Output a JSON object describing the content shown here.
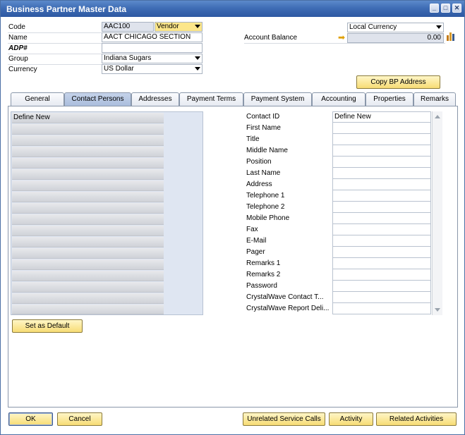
{
  "window": {
    "title": "Business Partner Master Data"
  },
  "header": {
    "code_label": "Code",
    "code_value": "AAC100",
    "type_value": "Vendor",
    "name_label": "Name",
    "name_value": "AACT CHICAGO SECTION",
    "adp_label": "ADP#",
    "adp_value": "",
    "group_label": "Group",
    "group_value": "Indiana Sugars",
    "currency_label": "Currency",
    "currency_value": "US Dollar",
    "currency_mode_value": "Local Currency",
    "account_balance_label": "Account Balance",
    "account_balance_value": "0.00",
    "copy_bp_address_label": "Copy BP Address"
  },
  "tabs": [
    {
      "label": "General"
    },
    {
      "label": "Contact Persons"
    },
    {
      "label": "Addresses"
    },
    {
      "label": "Payment Terms"
    },
    {
      "label": "Payment System"
    },
    {
      "label": "Accounting"
    },
    {
      "label": "Properties"
    },
    {
      "label": "Remarks"
    }
  ],
  "contacts_list": {
    "items": [
      "Define New"
    ],
    "set_default_label": "Set as Default"
  },
  "contact_details": [
    {
      "label": "Contact ID",
      "value": "Define New"
    },
    {
      "label": "First Name",
      "value": ""
    },
    {
      "label": "Title",
      "value": ""
    },
    {
      "label": "Middle Name",
      "value": ""
    },
    {
      "label": "Position",
      "value": ""
    },
    {
      "label": "Last Name",
      "value": ""
    },
    {
      "label": "Address",
      "value": ""
    },
    {
      "label": "Telephone 1",
      "value": ""
    },
    {
      "label": "Telephone 2",
      "value": ""
    },
    {
      "label": "Mobile Phone",
      "value": ""
    },
    {
      "label": "Fax",
      "value": ""
    },
    {
      "label": "E-Mail",
      "value": ""
    },
    {
      "label": "Pager",
      "value": ""
    },
    {
      "label": "Remarks 1",
      "value": ""
    },
    {
      "label": "Remarks 2",
      "value": ""
    },
    {
      "label": "Password",
      "value": ""
    },
    {
      "label": "CrystalWave Contact T...",
      "value": ""
    },
    {
      "label": "CrystalWave Report Deli...",
      "value": ""
    }
  ],
  "footer": {
    "ok_label": "OK",
    "cancel_label": "Cancel",
    "unrelated_service_calls_label": "Unrelated Service Calls",
    "activity_label": "Activity",
    "related_activities_label": "Related Activities"
  }
}
